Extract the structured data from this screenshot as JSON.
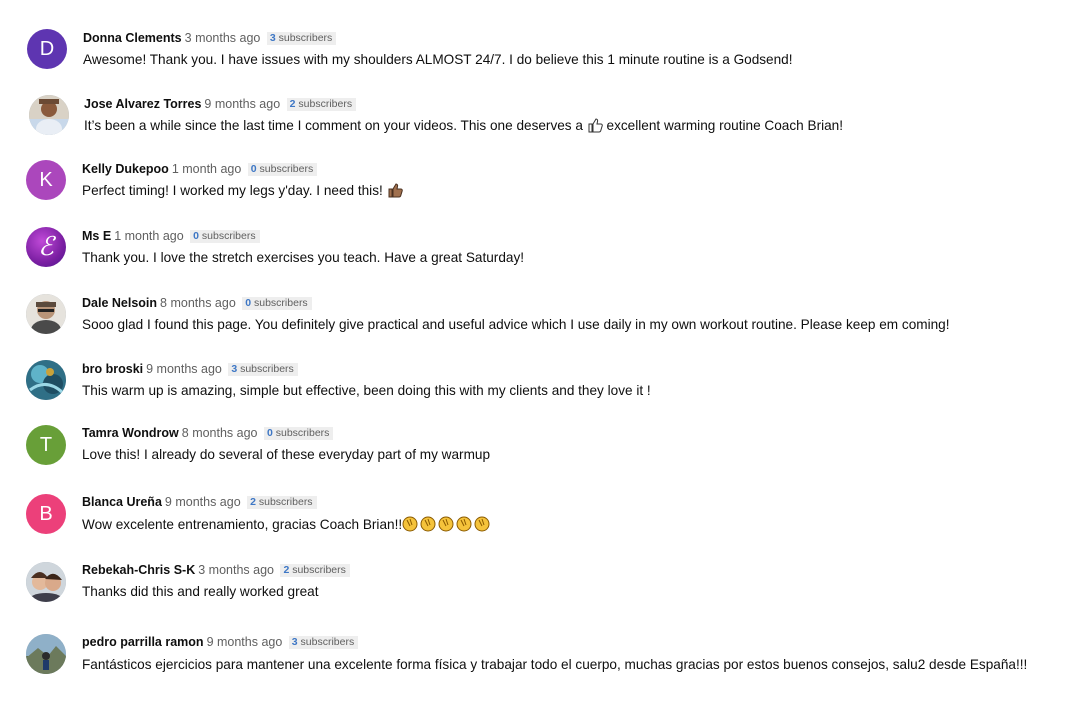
{
  "comments": [
    {
      "author": "Donna Clements",
      "time": "3 months ago",
      "subscribers_count": "3",
      "subscribers_label": "subscribers",
      "text": "Awesome! Thank you. I have issues with my shoulders ALMOST 24/7. I do believe this 1 minute routine is a Godsend!",
      "avatar_letter": "D",
      "avatar_color": "#5e35b1"
    },
    {
      "author": "Jose Alvarez Torres",
      "time": "9 months ago",
      "subscribers_count": "2",
      "subscribers_label": "subscribers",
      "text_before": "It’s been a while since the last time I comment on your videos. This one deserves a",
      "text_after": "excellent warming routine Coach Brian!",
      "emoji": "thumbs-up"
    },
    {
      "author": "Kelly Dukepoo",
      "time": "1 month ago",
      "subscribers_count": "0",
      "subscribers_label": "subscribers",
      "text_before": "Perfect timing! I worked my legs y'day. I need this!",
      "emoji": "thumbs-up-medium-skin",
      "avatar_letter": "K",
      "avatar_color": "#ab47bc"
    },
    {
      "author": "Ms E",
      "time": "1 month ago",
      "subscribers_count": "0",
      "subscribers_label": "subscribers",
      "text": "Thank you. I love the stretch exercises you teach. Have a great Saturday!",
      "avatar_letter": "ℰ",
      "avatar_color": "#8e24aa"
    },
    {
      "author": "Dale Nelsoin",
      "time": "8 months ago",
      "subscribers_count": "0",
      "subscribers_label": "subscribers",
      "text": "Sooo glad I found this page. You definitely give practical and useful advice which I use daily in my own workout routine. Please keep em coming!"
    },
    {
      "author": "bro broski",
      "time": "9 months ago",
      "subscribers_count": "3",
      "subscribers_label": "subscribers",
      "text": "This warm up is amazing, simple but effective, been doing this with my clients and they love it !"
    },
    {
      "author": "Tamra Wondrow",
      "time": "8 months ago",
      "subscribers_count": "0",
      "subscribers_label": "subscribers",
      "text": "Love this! I already do several of these everyday part of my warmup",
      "avatar_letter": "T",
      "avatar_color": "#689f38"
    },
    {
      "author": "Blanca Ureña",
      "time": "9 months ago",
      "subscribers_count": "2",
      "subscribers_label": "subscribers",
      "text_before": "Wow excelente entrenamiento, gracias Coach Brian!!",
      "emoji": "clapping-hands",
      "emoji_count": 5,
      "avatar_letter": "B",
      "avatar_color": "#ec407a"
    },
    {
      "author": "Rebekah-Chris S-K",
      "time": "3 months ago",
      "subscribers_count": "2",
      "subscribers_label": "subscribers",
      "text": "Thanks did this and really worked great"
    },
    {
      "author": "pedro parrilla ramon",
      "time": "9 months ago",
      "subscribers_count": "3",
      "subscribers_label": "subscribers",
      "text": "Fantásticos ejercicios para mantener una excelente forma física y trabajar todo el cuerpo, muchas gracias por estos buenos consejos, salu2 desde España!!!"
    }
  ]
}
